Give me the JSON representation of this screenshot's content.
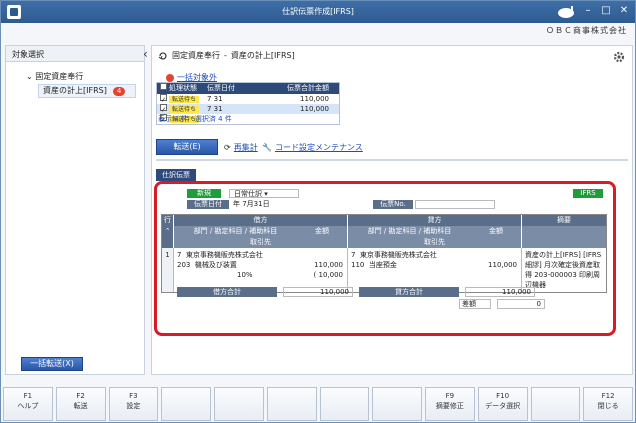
{
  "window": {
    "title": "仕訳伝票作成[IFRS]",
    "company": "ＯＢＣ商事株式会社"
  },
  "left": {
    "header": "対象選択",
    "tree": [
      {
        "label": "固定資産奉行"
      },
      {
        "label": "資産の計上[IFRS]",
        "badge": "4"
      }
    ],
    "bulk_send": "一括転送(X)"
  },
  "main": {
    "breadcrumb": [
      "固定資産奉行",
      "-",
      "資産の計上[IFRS]"
    ],
    "exclude_link": "一括対象外",
    "list": {
      "headers": [
        "処理状態",
        "伝票日付",
        "伝票合計金額"
      ],
      "rows": [
        {
          "checked": true,
          "status": "転送待ち",
          "date": "7 31",
          "amount": "110,000",
          "selected": false
        },
        {
          "checked": true,
          "status": "転送待ち",
          "date": "7 31",
          "amount": "110,000",
          "selected": true
        },
        {
          "checked": true,
          "status": "転送待ち",
          "date": "",
          "amount": "",
          "selected": false
        }
      ],
      "count_text": "表示 4 件　選択済 4 件"
    },
    "send_button": "転送(E)",
    "recalc_link": "再集計",
    "codeset_link": "コード設定メンテナンス",
    "tab": "仕訳伝票",
    "slip": {
      "kind": "新規",
      "journal_type": "日常仕訳",
      "date_label": "伝票日付",
      "date_value": "年  7月31日",
      "no_label": "伝票No.",
      "ifrs": "IFRS",
      "grid": {
        "h1": [
          "行",
          "借方",
          "貸方",
          "摘要"
        ],
        "h2_debit": [
          "部門 / 勘定科目 / 補助科目",
          "金額"
        ],
        "h2_credit": [
          "部門 / 勘定科目 / 補助科目",
          "金額"
        ],
        "client": "取引先",
        "row": {
          "idx": "1",
          "debit_dept": "7",
          "debit_acct": "203",
          "debit_sub": "機械及び装置",
          "debit_client": "東京事務機販売株式会社",
          "debit_amount": "110,000",
          "debit_tax": "( 10,000",
          "debit_rate": "10%",
          "credit_dept": "7",
          "credit_acct": "110",
          "credit_sub": "当座預金",
          "credit_client": "東京事務機販売株式会社",
          "credit_amount": "110,000",
          "memo": "資産の計上[IFRS] [IFRS細謬] 月次確定後資産取得 203-000003 印刷周辺機器"
        }
      },
      "totals": {
        "debit_label": "借方合計",
        "debit_value": "110,000",
        "credit_label": "貸方合計",
        "credit_value": "110,000",
        "diff_label": "差額",
        "diff_value": "0"
      }
    }
  },
  "fkeys": [
    {
      "key": "F1",
      "label": "ヘルプ"
    },
    {
      "key": "F2",
      "label": "転送"
    },
    {
      "key": "F3",
      "label": "設定"
    },
    {
      "key": "",
      "label": ""
    },
    {
      "key": "",
      "label": ""
    },
    {
      "key": "",
      "label": ""
    },
    {
      "key": "",
      "label": ""
    },
    {
      "key": "",
      "label": ""
    },
    {
      "key": "F9",
      "label": "摘要修正"
    },
    {
      "key": "F10",
      "label": "データ選択"
    },
    {
      "key": "",
      "label": ""
    },
    {
      "key": "F12",
      "label": "閉じる"
    }
  ]
}
